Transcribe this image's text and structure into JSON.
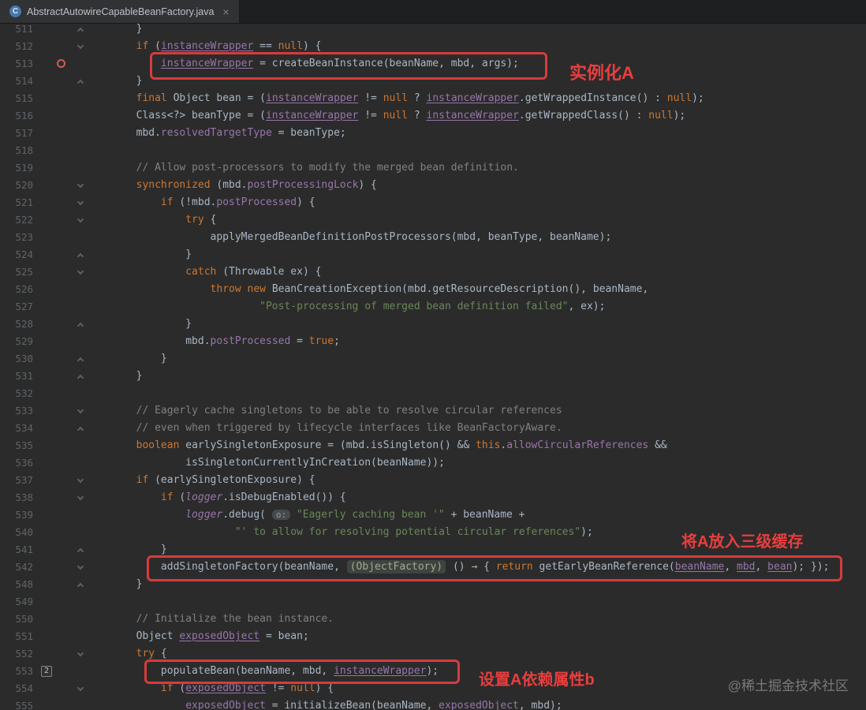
{
  "tab": {
    "title": "AbstractAutowireCapableBeanFactory.java",
    "icon_letter": "C",
    "close_glyph": "×"
  },
  "annotations": {
    "instantiate": "实例化A",
    "three_level_cache": "将A放入三级缓存",
    "populate": "设置A依赖属性b"
  },
  "watermark": "@稀土掘金技术社区",
  "colors": {
    "editor_bg": "#2b2b2b",
    "keyword": "#cc7832",
    "field": "#9876aa",
    "string": "#6a8759",
    "comment": "#808080",
    "plain": "#a9b7c6",
    "annotation_red": "#d63c3c"
  },
  "editor": {
    "lines": [
      {
        "num": "511",
        "fold": "end",
        "tokens": [
          [
            "p",
            "        }"
          ]
        ]
      },
      {
        "num": "512",
        "fold": "start",
        "tokens": [
          [
            "p",
            "        "
          ],
          [
            "k",
            "if"
          ],
          [
            "p",
            " ("
          ],
          [
            "fu",
            "instanceWrapper"
          ],
          [
            "p",
            " == "
          ],
          [
            "k",
            "null"
          ],
          [
            "p",
            ") {"
          ]
        ]
      },
      {
        "num": "513",
        "breakpoint": true,
        "tokens": [
          [
            "p",
            "            "
          ],
          [
            "fu",
            "instanceWrapper"
          ],
          [
            "p",
            " = createBeanInstance(beanName, mbd, args);"
          ]
        ]
      },
      {
        "num": "514",
        "fold": "end",
        "tokens": [
          [
            "p",
            "        }"
          ]
        ]
      },
      {
        "num": "515",
        "tokens": [
          [
            "p",
            "        "
          ],
          [
            "k",
            "final"
          ],
          [
            "p",
            " Object bean = ("
          ],
          [
            "fu",
            "instanceWrapper"
          ],
          [
            "p",
            " != "
          ],
          [
            "k",
            "null"
          ],
          [
            "p",
            " ? "
          ],
          [
            "fu",
            "instanceWrapper"
          ],
          [
            "p",
            ".getWrappedInstance() : "
          ],
          [
            "k",
            "null"
          ],
          [
            "p",
            ");"
          ]
        ]
      },
      {
        "num": "516",
        "tokens": [
          [
            "p",
            "        Class<?> beanType = ("
          ],
          [
            "fu",
            "instanceWrapper"
          ],
          [
            "p",
            " != "
          ],
          [
            "k",
            "null"
          ],
          [
            "p",
            " ? "
          ],
          [
            "fu",
            "instanceWrapper"
          ],
          [
            "p",
            ".getWrappedClass() : "
          ],
          [
            "k",
            "null"
          ],
          [
            "p",
            ");"
          ]
        ]
      },
      {
        "num": "517",
        "tokens": [
          [
            "p",
            "        mbd."
          ],
          [
            "f",
            "resolvedTargetType"
          ],
          [
            "p",
            " = beanType;"
          ]
        ]
      },
      {
        "num": "518",
        "tokens": []
      },
      {
        "num": "519",
        "tokens": [
          [
            "p",
            "        "
          ],
          [
            "c",
            "// Allow post-processors to modify the merged bean definition."
          ]
        ]
      },
      {
        "num": "520",
        "fold": "start",
        "tokens": [
          [
            "p",
            "        "
          ],
          [
            "k",
            "synchronized"
          ],
          [
            "p",
            " (mbd."
          ],
          [
            "f",
            "postProcessingLock"
          ],
          [
            "p",
            ") {"
          ]
        ]
      },
      {
        "num": "521",
        "fold": "start",
        "tokens": [
          [
            "p",
            "            "
          ],
          [
            "k",
            "if"
          ],
          [
            "p",
            " (!mbd."
          ],
          [
            "f",
            "postProcessed"
          ],
          [
            "p",
            ") {"
          ]
        ]
      },
      {
        "num": "522",
        "fold": "start",
        "tokens": [
          [
            "p",
            "                "
          ],
          [
            "k",
            "try"
          ],
          [
            "p",
            " {"
          ]
        ]
      },
      {
        "num": "523",
        "tokens": [
          [
            "p",
            "                    applyMergedBeanDefinitionPostProcessors(mbd, beanType, beanName);"
          ]
        ]
      },
      {
        "num": "524",
        "fold": "end",
        "tokens": [
          [
            "p",
            "                }"
          ]
        ]
      },
      {
        "num": "525",
        "fold": "start",
        "tokens": [
          [
            "p",
            "                "
          ],
          [
            "k",
            "catch"
          ],
          [
            "p",
            " (Throwable ex) {"
          ]
        ]
      },
      {
        "num": "526",
        "tokens": [
          [
            "p",
            "                    "
          ],
          [
            "k",
            "throw"
          ],
          [
            "p",
            " "
          ],
          [
            "k",
            "new"
          ],
          [
            "p",
            " BeanCreationException(mbd.getResourceDescription(), beanName,"
          ]
        ]
      },
      {
        "num": "527",
        "tokens": [
          [
            "p",
            "                            "
          ],
          [
            "s",
            "\"Post-processing of merged bean definition failed\""
          ],
          [
            "p",
            ", ex);"
          ]
        ]
      },
      {
        "num": "528",
        "fold": "end",
        "tokens": [
          [
            "p",
            "                }"
          ]
        ]
      },
      {
        "num": "529",
        "tokens": [
          [
            "p",
            "                mbd."
          ],
          [
            "f",
            "postProcessed"
          ],
          [
            "p",
            " = "
          ],
          [
            "k",
            "true"
          ],
          [
            "p",
            ";"
          ]
        ]
      },
      {
        "num": "530",
        "fold": "end",
        "tokens": [
          [
            "p",
            "            }"
          ]
        ]
      },
      {
        "num": "531",
        "fold": "end",
        "tokens": [
          [
            "p",
            "        }"
          ]
        ]
      },
      {
        "num": "532",
        "tokens": []
      },
      {
        "num": "533",
        "fold": "start",
        "tokens": [
          [
            "p",
            "        "
          ],
          [
            "c",
            "// Eagerly cache singletons to be able to resolve circular references"
          ]
        ]
      },
      {
        "num": "534",
        "fold": "end",
        "tokens": [
          [
            "p",
            "        "
          ],
          [
            "c",
            "// even when triggered by lifecycle interfaces like BeanFactoryAware."
          ]
        ]
      },
      {
        "num": "535",
        "tokens": [
          [
            "p",
            "        "
          ],
          [
            "k",
            "boolean"
          ],
          [
            "p",
            " earlySingletonExposure = (mbd.isSingleton() && "
          ],
          [
            "k",
            "this"
          ],
          [
            "p",
            "."
          ],
          [
            "f",
            "allowCircularReferences"
          ],
          [
            "p",
            " &&"
          ]
        ]
      },
      {
        "num": "536",
        "tokens": [
          [
            "p",
            "                isSingletonCurrentlyInCreation(beanName));"
          ]
        ]
      },
      {
        "num": "537",
        "fold": "start",
        "tokens": [
          [
            "p",
            "        "
          ],
          [
            "k",
            "if"
          ],
          [
            "p",
            " (earlySingletonExposure) {"
          ]
        ]
      },
      {
        "num": "538",
        "fold": "start",
        "tokens": [
          [
            "p",
            "            "
          ],
          [
            "k",
            "if"
          ],
          [
            "p",
            " ("
          ],
          [
            "fi",
            "logger"
          ],
          [
            "p",
            ".isDebugEnabled()) {"
          ]
        ]
      },
      {
        "num": "539",
        "tokens": [
          [
            "p",
            "                "
          ],
          [
            "fi",
            "logger"
          ],
          [
            "p",
            ".debug( "
          ],
          [
            "hint",
            "o:"
          ],
          [
            "p",
            " "
          ],
          [
            "s",
            "\"Eagerly caching bean '\""
          ],
          [
            "p",
            " + beanName +"
          ]
        ]
      },
      {
        "num": "540",
        "tokens": [
          [
            "p",
            "                        "
          ],
          [
            "s",
            "\"' to allow for resolving potential circular references\""
          ],
          [
            "p",
            ");"
          ]
        ]
      },
      {
        "num": "541",
        "fold": "end",
        "tokens": [
          [
            "p",
            "            }"
          ]
        ]
      },
      {
        "num": "542",
        "fold": "start",
        "tokens": [
          [
            "p",
            "            addSingletonFactory(beanName, "
          ],
          [
            "chip",
            "(ObjectFactory)"
          ],
          [
            "p",
            " () → { "
          ],
          [
            "k",
            "return"
          ],
          [
            "p",
            " getEarlyBeanReference("
          ],
          [
            "fu",
            "beanName"
          ],
          [
            "p",
            ", "
          ],
          [
            "fu",
            "mbd"
          ],
          [
            "p",
            ", "
          ],
          [
            "fu",
            "bean"
          ],
          [
            "p",
            "); });"
          ]
        ]
      },
      {
        "num": "548",
        "fold": "end",
        "tokens": [
          [
            "p",
            "        }"
          ]
        ]
      },
      {
        "num": "549",
        "tokens": []
      },
      {
        "num": "550",
        "tokens": [
          [
            "p",
            "        "
          ],
          [
            "c",
            "// Initialize the bean instance."
          ]
        ]
      },
      {
        "num": "551",
        "tokens": [
          [
            "p",
            "        Object "
          ],
          [
            "fu",
            "exposedObject"
          ],
          [
            "p",
            " = bean;"
          ]
        ]
      },
      {
        "num": "552",
        "fold": "start",
        "tokens": [
          [
            "p",
            "        "
          ],
          [
            "k",
            "try"
          ],
          [
            "p",
            " {"
          ]
        ]
      },
      {
        "num": "553",
        "bookmark": "2",
        "tokens": [
          [
            "p",
            "            populateBean(beanName, mbd, "
          ],
          [
            "fu",
            "instanceWrapper"
          ],
          [
            "p",
            ");"
          ]
        ]
      },
      {
        "num": "554",
        "fold": "start",
        "tokens": [
          [
            "p",
            "            "
          ],
          [
            "k",
            "if"
          ],
          [
            "p",
            " ("
          ],
          [
            "fu",
            "exposedObject"
          ],
          [
            "p",
            " != "
          ],
          [
            "k",
            "null"
          ],
          [
            "p",
            ") {"
          ]
        ]
      },
      {
        "num": "555",
        "tokens": [
          [
            "p",
            "                "
          ],
          [
            "fu",
            "exposedObject"
          ],
          [
            "p",
            " = initializeBean(beanName, "
          ],
          [
            "fu",
            "exposedObject"
          ],
          [
            "p",
            ", mbd);"
          ]
        ]
      }
    ]
  }
}
